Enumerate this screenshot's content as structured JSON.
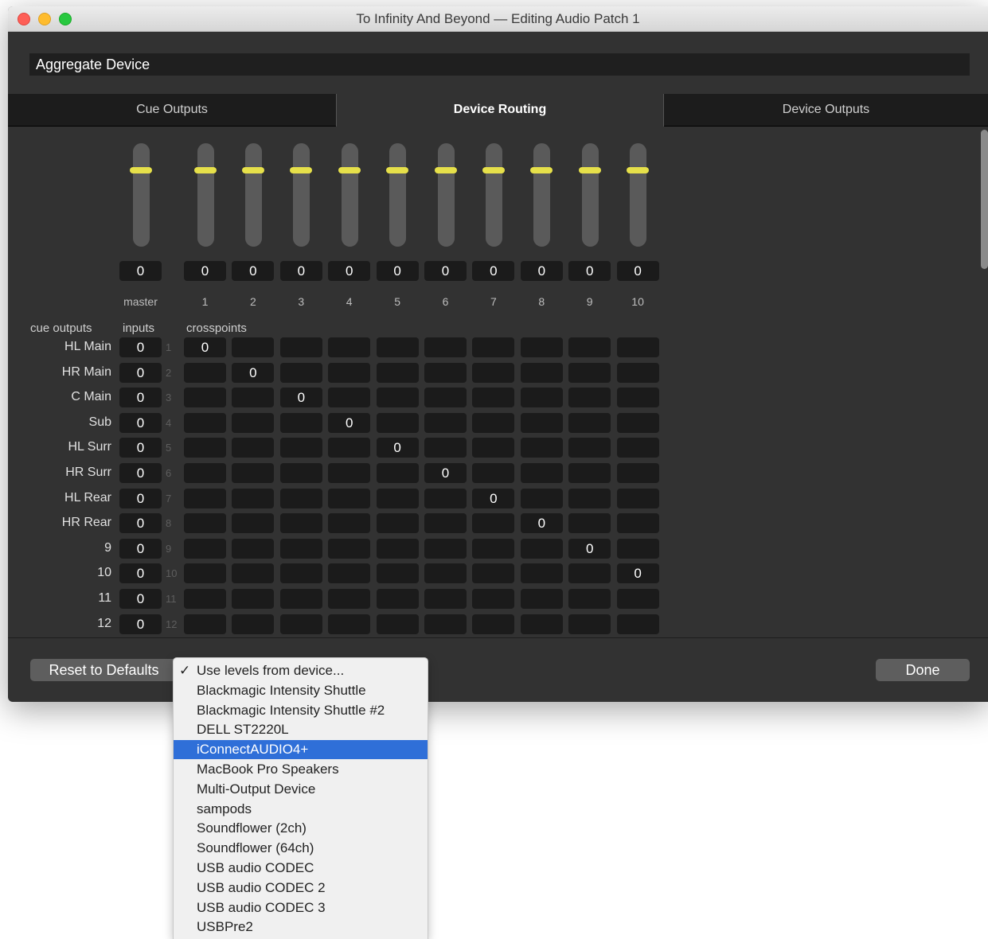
{
  "window": {
    "title": "To Infinity And Beyond — Editing Audio Patch 1"
  },
  "device": {
    "name": "Aggregate Device"
  },
  "tabs": [
    "Cue Outputs",
    "Device Routing",
    "Device Outputs"
  ],
  "active_tab": "Device Routing",
  "faders": {
    "master_value": "0",
    "master_label": "master",
    "channels": [
      {
        "label": "1",
        "value": "0"
      },
      {
        "label": "2",
        "value": "0"
      },
      {
        "label": "3",
        "value": "0"
      },
      {
        "label": "4",
        "value": "0"
      },
      {
        "label": "5",
        "value": "0"
      },
      {
        "label": "6",
        "value": "0"
      },
      {
        "label": "7",
        "value": "0"
      },
      {
        "label": "8",
        "value": "0"
      },
      {
        "label": "9",
        "value": "0"
      },
      {
        "label": "10",
        "value": "0"
      }
    ]
  },
  "headers": {
    "cue_outputs": "cue outputs",
    "inputs": "inputs",
    "crosspoints": "crosspoints"
  },
  "rows": [
    {
      "name": "HL Main",
      "input": "0",
      "num": "1"
    },
    {
      "name": "HR Main",
      "input": "0",
      "num": "2"
    },
    {
      "name": "C Main",
      "input": "0",
      "num": "3"
    },
    {
      "name": "Sub",
      "input": "0",
      "num": "4"
    },
    {
      "name": "HL Surr",
      "input": "0",
      "num": "5"
    },
    {
      "name": "HR Surr",
      "input": "0",
      "num": "6"
    },
    {
      "name": "HL Rear",
      "input": "0",
      "num": "7"
    },
    {
      "name": "HR Rear",
      "input": "0",
      "num": "8"
    },
    {
      "name": "9",
      "input": "0",
      "num": "9"
    },
    {
      "name": "10",
      "input": "0",
      "num": "10"
    },
    {
      "name": "11",
      "input": "0",
      "num": "11"
    },
    {
      "name": "12",
      "input": "0",
      "num": "12"
    }
  ],
  "crosspoint_value": "0",
  "buttons": {
    "reset": "Reset to Defaults",
    "done": "Done"
  },
  "menu": {
    "items": [
      "Use levels from device...",
      "Blackmagic Intensity Shuttle",
      "Blackmagic Intensity Shuttle #2",
      "DELL ST2220L",
      "iConnectAUDIO4+",
      "MacBook Pro Speakers",
      "Multi-Output Device",
      "sampods",
      "Soundflower (2ch)",
      "Soundflower (64ch)",
      "USB audio CODEC",
      "USB audio CODEC 2",
      "USB audio CODEC 3",
      "USBPre2"
    ],
    "checked_index": 0,
    "highlighted_index": 4,
    "check_mark": "✓"
  },
  "colors": {
    "fader_knob": "#e6e04a",
    "menu_highlight": "#2f6fd8"
  }
}
